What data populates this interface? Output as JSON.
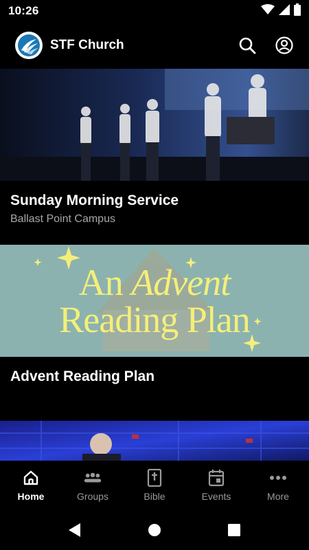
{
  "status_bar": {
    "time": "10:26",
    "icons": [
      "wifi-icon",
      "signal-icon",
      "battery-icon"
    ]
  },
  "header": {
    "title": "STF Church",
    "logo_icon": "church-logo-icon",
    "actions": [
      "search-icon",
      "account-icon"
    ]
  },
  "feed": {
    "cards": [
      {
        "title": "Sunday Morning Service",
        "subtitle": "Ballast Point Campus",
        "image": "worship-band-stage-photo"
      },
      {
        "title": "Advent Reading Plan",
        "subtitle": "",
        "image": "advent-reading-plan-art",
        "art_text": {
          "line1_a": "An",
          "line1_b": "Advent",
          "line2": "Reading Plan"
        }
      },
      {
        "title": "",
        "subtitle": "",
        "image": "preacher-stage-photo"
      }
    ]
  },
  "bottom_nav": {
    "items": [
      {
        "label": "Home",
        "icon": "home-icon",
        "active": true
      },
      {
        "label": "Groups",
        "icon": "groups-icon",
        "active": false
      },
      {
        "label": "Bible",
        "icon": "bible-icon",
        "active": false
      },
      {
        "label": "Events",
        "icon": "calendar-icon",
        "active": false
      },
      {
        "label": "More",
        "icon": "more-icon",
        "active": false
      }
    ]
  },
  "system_nav": [
    "back-icon",
    "home-circle-icon",
    "recents-icon"
  ],
  "colors": {
    "background": "#000000",
    "advent_bg": "#8cb2b0",
    "advent_text": "#f4ef7a",
    "muted_text": "#a8a8a8",
    "stage_blue": "#2a3fd6"
  }
}
